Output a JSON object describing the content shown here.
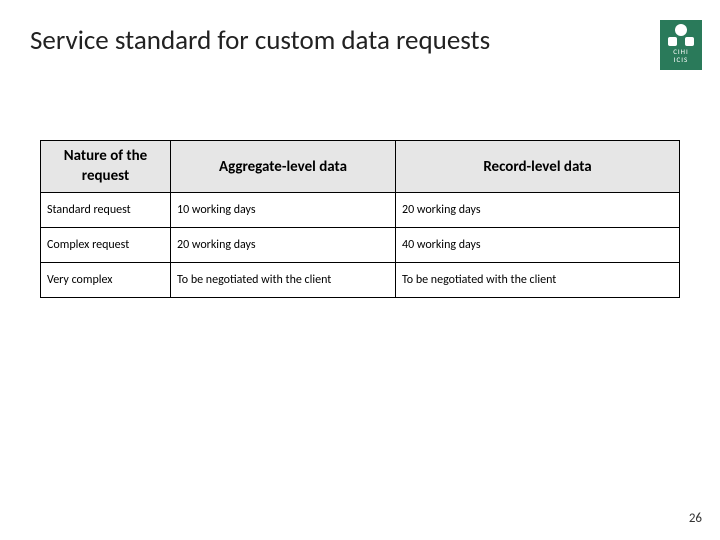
{
  "title": "Service standard for custom data requests",
  "logo": {
    "line1": "CIHI",
    "line2": "ICIS"
  },
  "table": {
    "headers": {
      "nature": "Nature of the request",
      "aggregate": "Aggregate-level data",
      "record": "Record-level data"
    },
    "rows": [
      {
        "nature": "Standard request",
        "aggregate": "10 working days",
        "record": "20 working days"
      },
      {
        "nature": "Complex request",
        "aggregate": "20 working days",
        "record": "40 working days"
      },
      {
        "nature": "Very complex",
        "aggregate": "To be negotiated with the client",
        "record": "To be negotiated with the client"
      }
    ]
  },
  "page_number": "26"
}
